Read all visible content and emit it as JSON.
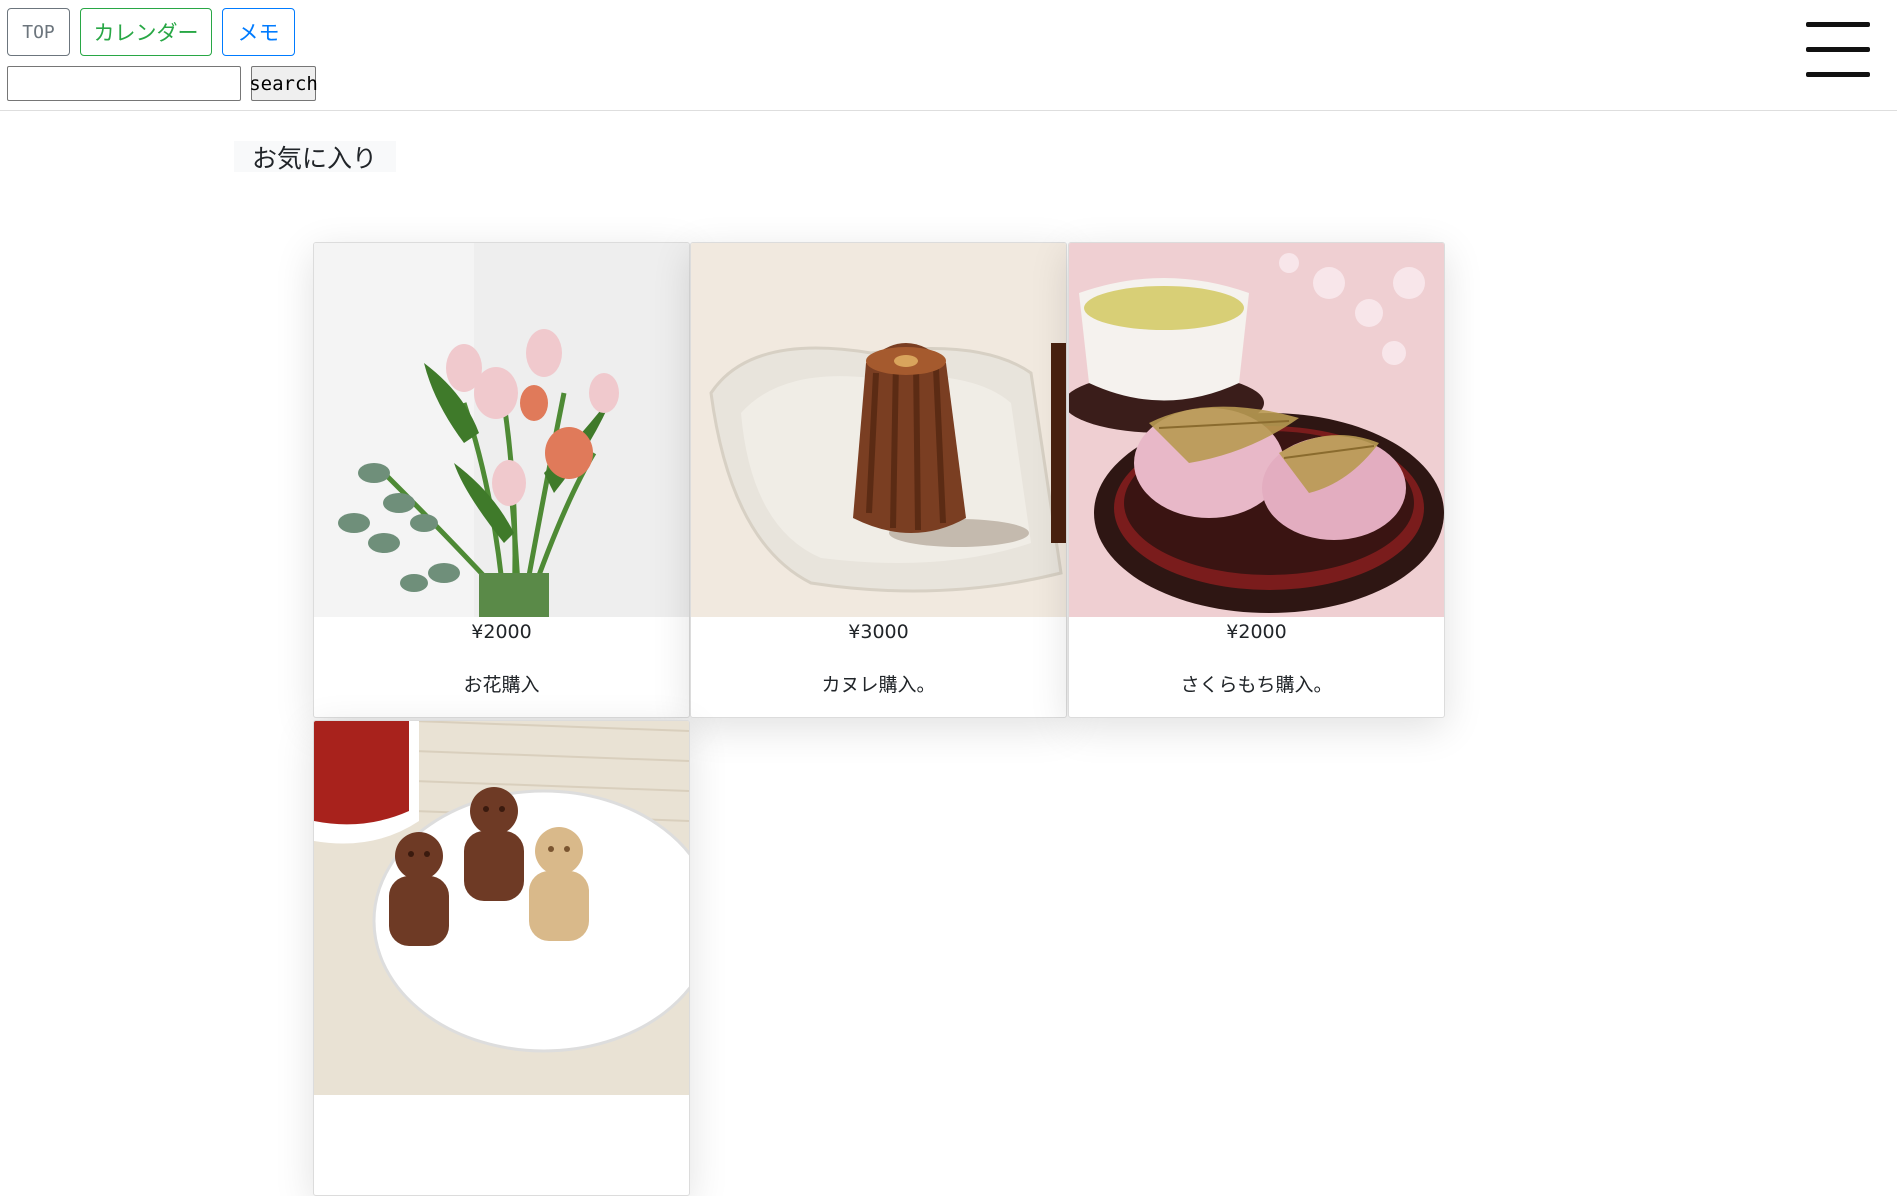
{
  "header": {
    "nav": {
      "top_label": "TOP",
      "calendar_label": "カレンダー",
      "memo_label": "メモ"
    },
    "search": {
      "value": "",
      "button_label": "search"
    }
  },
  "main": {
    "section_title": "お気に入り",
    "cards": [
      {
        "price": "¥2000",
        "caption": "お花購入"
      },
      {
        "price": "¥3000",
        "caption": "カヌレ購入。"
      },
      {
        "price": "¥2000",
        "caption": "さくらもち購入。"
      },
      {
        "price": "",
        "caption": ""
      }
    ]
  },
  "colors": {
    "nav_top": "#6c757d",
    "nav_calendar": "#28a745",
    "nav_memo": "#007bff"
  }
}
